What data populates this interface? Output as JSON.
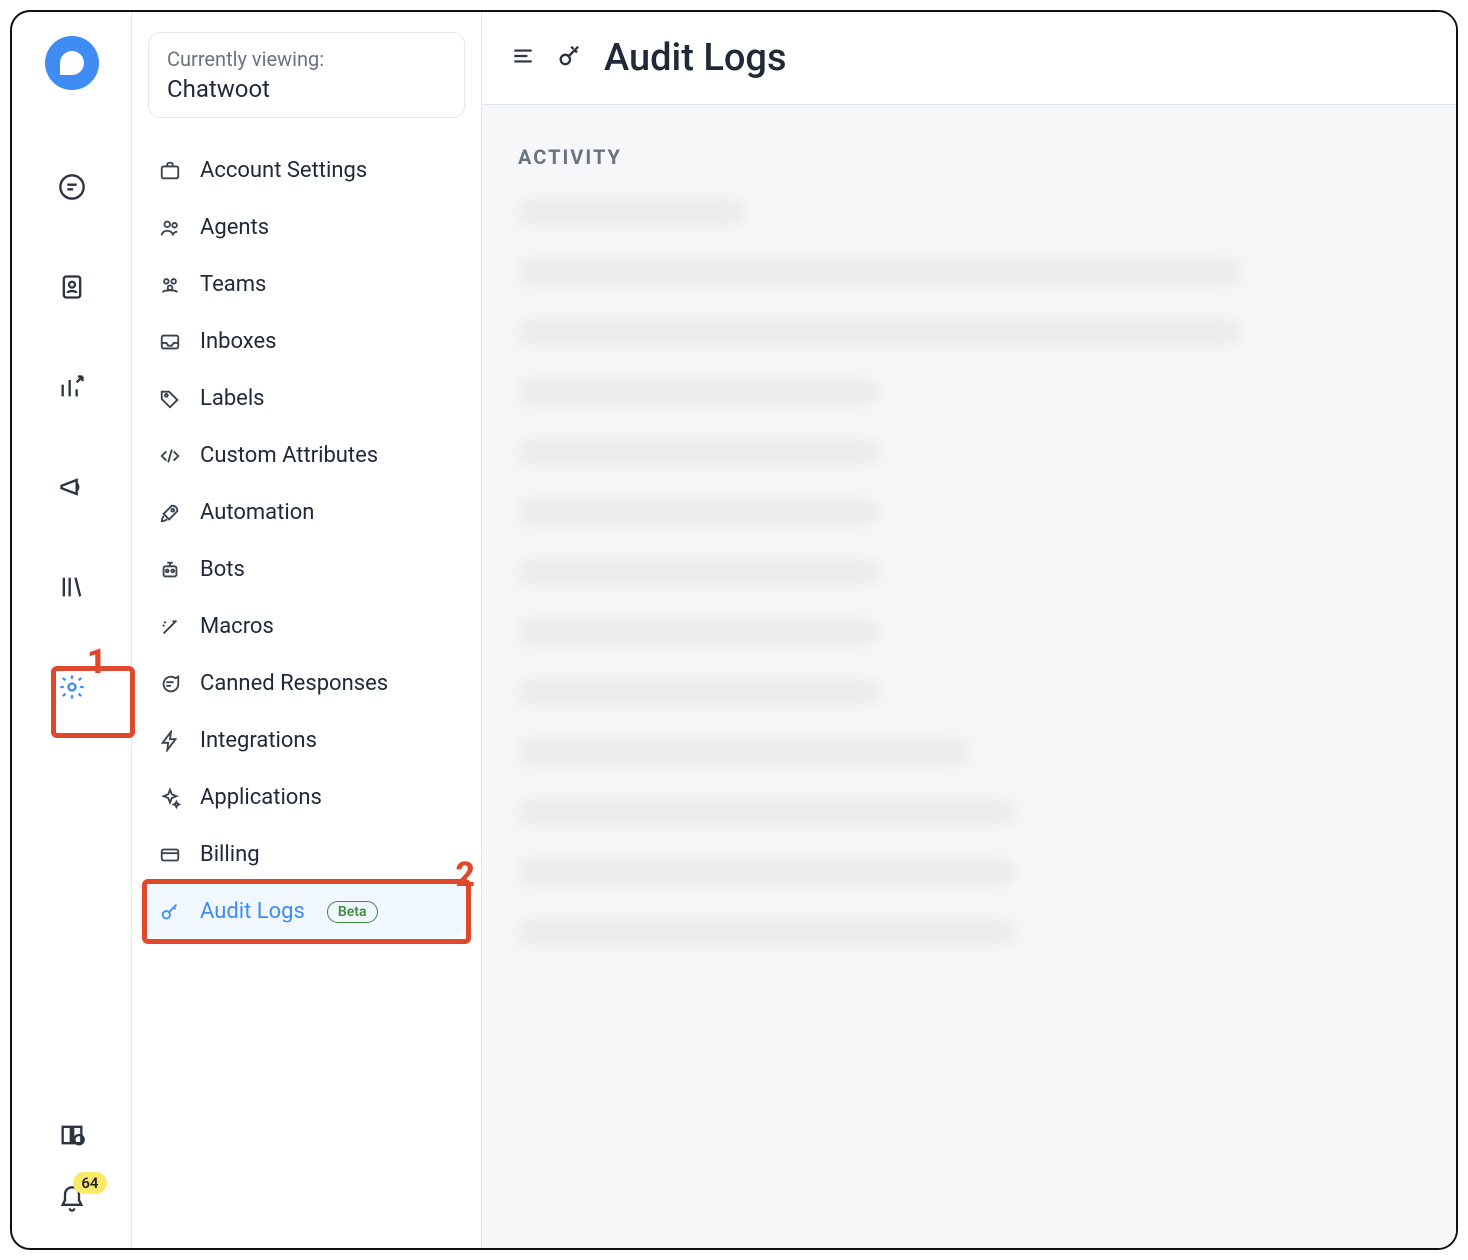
{
  "rail": {
    "badge_count": "64"
  },
  "viewer": {
    "label": "Currently viewing:",
    "name": "Chatwoot"
  },
  "settings_menu": [
    {
      "key": "account",
      "label": "Account Settings",
      "icon": "briefcase-icon"
    },
    {
      "key": "agents",
      "label": "Agents",
      "icon": "people-icon"
    },
    {
      "key": "teams",
      "label": "Teams",
      "icon": "group-icon"
    },
    {
      "key": "inboxes",
      "label": "Inboxes",
      "icon": "inbox-icon"
    },
    {
      "key": "labels",
      "label": "Labels",
      "icon": "tag-icon"
    },
    {
      "key": "custom",
      "label": "Custom Attributes",
      "icon": "code-icon"
    },
    {
      "key": "automation",
      "label": "Automation",
      "icon": "rocket-icon"
    },
    {
      "key": "bots",
      "label": "Bots",
      "icon": "robot-icon"
    },
    {
      "key": "macros",
      "label": "Macros",
      "icon": "wand-icon"
    },
    {
      "key": "canned",
      "label": "Canned Responses",
      "icon": "chat-icon"
    },
    {
      "key": "integrations",
      "label": "Integrations",
      "icon": "bolt-icon"
    },
    {
      "key": "applications",
      "label": "Applications",
      "icon": "sparkle-icon"
    },
    {
      "key": "billing",
      "label": "Billing",
      "icon": "card-icon"
    },
    {
      "key": "audit",
      "label": "Audit Logs",
      "icon": "key-icon",
      "active": true,
      "badge": "Beta"
    }
  ],
  "callouts": {
    "one": "1",
    "two": "2"
  },
  "header": {
    "title": "Audit Logs"
  },
  "activity": {
    "section_label": "ACTIVITY",
    "row_widths_pct": [
      25,
      80,
      80,
      40,
      40,
      40,
      40,
      40,
      40,
      50,
      55,
      55,
      55
    ]
  }
}
